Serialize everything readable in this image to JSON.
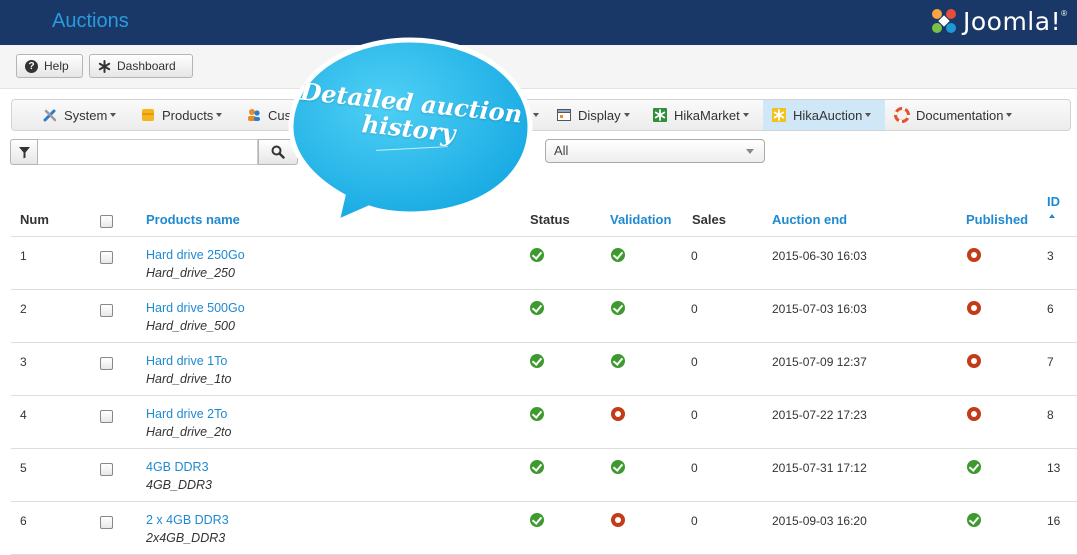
{
  "header": {
    "title": "Auctions",
    "logo_text": "Joomla!"
  },
  "toolbar": {
    "help_label": "Help",
    "dashboard_label": "Dashboard"
  },
  "menu": {
    "items": [
      {
        "label": "System",
        "icon": "tools-icon"
      },
      {
        "label": "Products",
        "icon": "products-icon"
      },
      {
        "label": "Cus",
        "icon": "customers-icon"
      },
      {
        "label": "Display",
        "icon": "display-icon"
      },
      {
        "label": "HikaMarket",
        "icon": "hikamarket-icon"
      },
      {
        "label": "HikaAuction",
        "icon": "hikaauction-icon",
        "active": true
      },
      {
        "label": "Documentation",
        "icon": "lifebuoy-icon"
      }
    ]
  },
  "filter": {
    "search_value": "",
    "select_value": "All"
  },
  "callout": {
    "line1": "Detailed auction",
    "line2": "history"
  },
  "table": {
    "headers": {
      "num": "Num",
      "name": "Products name",
      "status": "Status",
      "validation": "Validation",
      "sales": "Sales",
      "end": "Auction end",
      "published": "Published",
      "id": "ID"
    },
    "rows": [
      {
        "num": "1",
        "name": "Hard drive 250Go",
        "code": "Hard_drive_250",
        "status": "ok",
        "validation": "ok",
        "sales": "0",
        "end": "2015-06-30 16:03",
        "published": "no",
        "id": "3"
      },
      {
        "num": "2",
        "name": "Hard drive 500Go",
        "code": "Hard_drive_500",
        "status": "ok",
        "validation": "ok",
        "sales": "0",
        "end": "2015-07-03 16:03",
        "published": "no",
        "id": "6"
      },
      {
        "num": "3",
        "name": "Hard drive 1To",
        "code": "Hard_drive_1to",
        "status": "ok",
        "validation": "ok",
        "sales": "0",
        "end": "2015-07-09 12:37",
        "published": "no",
        "id": "7"
      },
      {
        "num": "4",
        "name": "Hard drive 2To",
        "code": "Hard_drive_2to",
        "status": "ok",
        "validation": "no",
        "sales": "0",
        "end": "2015-07-22 17:23",
        "published": "no",
        "id": "8"
      },
      {
        "num": "5",
        "name": "4GB DDR3",
        "code": "4GB_DDR3",
        "status": "ok",
        "validation": "ok",
        "sales": "0",
        "end": "2015-07-31 17:12",
        "published": "ok",
        "id": "13"
      },
      {
        "num": "6",
        "name": "2 x 4GB DDR3",
        "code": "2x4GB_DDR3",
        "status": "ok",
        "validation": "no",
        "sales": "0",
        "end": "2015-09-03 16:20",
        "published": "ok",
        "id": "16"
      }
    ]
  },
  "colors": {
    "header_bg": "#1a3867",
    "title": "#2a9ae0",
    "link": "#1f8ad0",
    "ok": "#3e9a2f",
    "no": "#c23c18",
    "bubble": "#1fb6ec"
  }
}
